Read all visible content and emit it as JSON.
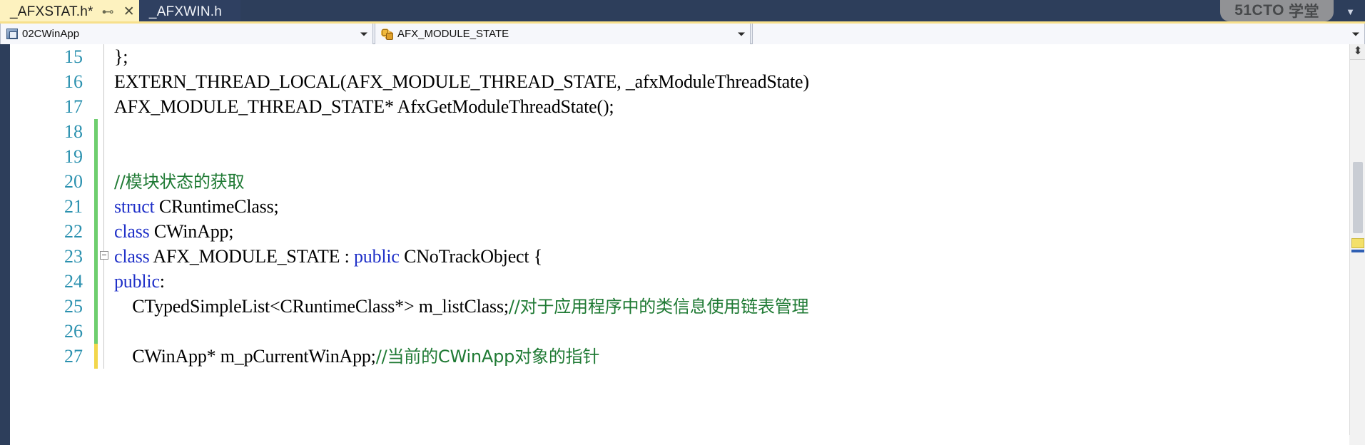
{
  "window": {
    "watermark_brand": "51CTO",
    "watermark_suffix": "学堂"
  },
  "tabs": {
    "items": [
      {
        "label": "_AFXSTAT.h*",
        "active": true,
        "pin_icon": "pin-icon",
        "close_icon": "close-icon"
      },
      {
        "label": "_AFXWIN.h",
        "active": false
      }
    ],
    "overflow_icon": "chevron-down-icon"
  },
  "navbar": {
    "scope_combo": {
      "value": "02CWinApp",
      "icon": "class-icon"
    },
    "type_combo": {
      "value": "AFX_MODULE_STATE",
      "icon": "struct-icon"
    },
    "member_combo": {
      "value": ""
    },
    "dropdown_icon": "chevron-down-icon"
  },
  "editor": {
    "split_icon": "split-view-icon",
    "lines": [
      {
        "num": "15",
        "change": "none",
        "fold": "none",
        "tokens": [
          {
            "t": "};",
            "c": "plain"
          }
        ]
      },
      {
        "num": "16",
        "change": "none",
        "fold": "none",
        "tokens": [
          {
            "t": "EXTERN_THREAD_LOCAL(AFX_MODULE_THREAD_STATE, _afxModuleThreadState)",
            "c": "plain"
          }
        ]
      },
      {
        "num": "17",
        "change": "none",
        "fold": "none",
        "tokens": [
          {
            "t": "AFX_MODULE_THREAD_STATE* AfxGetModuleThreadState();",
            "c": "plain"
          }
        ]
      },
      {
        "num": "18",
        "change": "green",
        "fold": "none",
        "tokens": [
          {
            "t": "",
            "c": "plain"
          }
        ]
      },
      {
        "num": "19",
        "change": "green",
        "fold": "none",
        "tokens": [
          {
            "t": "",
            "c": "plain"
          }
        ]
      },
      {
        "num": "20",
        "change": "green",
        "fold": "none",
        "tokens": [
          {
            "t": "//模块状态的获取",
            "c": "comment"
          }
        ]
      },
      {
        "num": "21",
        "change": "green",
        "fold": "none",
        "tokens": [
          {
            "t": "struct",
            "c": "keyword"
          },
          {
            "t": " CRuntimeClass;",
            "c": "plain"
          }
        ]
      },
      {
        "num": "22",
        "change": "green",
        "fold": "none",
        "tokens": [
          {
            "t": "class",
            "c": "keyword"
          },
          {
            "t": " CWinApp;",
            "c": "plain"
          }
        ]
      },
      {
        "num": "23",
        "change": "green",
        "fold": "collapse",
        "tokens": [
          {
            "t": "class",
            "c": "keyword"
          },
          {
            "t": " AFX_MODULE_STATE : ",
            "c": "plain"
          },
          {
            "t": "public",
            "c": "keyword"
          },
          {
            "t": " CNoTrackObject {",
            "c": "plain"
          }
        ]
      },
      {
        "num": "24",
        "change": "green",
        "fold": "none",
        "tokens": [
          {
            "t": "public",
            "c": "keyword"
          },
          {
            "t": ":",
            "c": "plain"
          }
        ]
      },
      {
        "num": "25",
        "change": "green",
        "fold": "none",
        "tokens": [
          {
            "t": "    CTypedSimpleList<CRuntimeClass*> m_listClass;",
            "c": "plain"
          },
          {
            "t": "//对于应用程序中的类信息使用链表管理",
            "c": "comment"
          }
        ]
      },
      {
        "num": "26",
        "change": "green",
        "fold": "none",
        "tokens": [
          {
            "t": "",
            "c": "plain"
          }
        ]
      },
      {
        "num": "27",
        "change": "yellow",
        "fold": "none",
        "tokens": [
          {
            "t": "    CWinApp* m_pCurrentWinApp;",
            "c": "plain"
          },
          {
            "t": "//当前的CWinApp对象的指针",
            "c": "comment"
          }
        ]
      }
    ]
  },
  "colors": {
    "tab_active_bg": "#fdf2bf",
    "tab_inactive_bg": "#2f4061",
    "chrome_bg": "#2d3e5b",
    "line_number": "#2b91af",
    "keyword": "#1f30c8",
    "comment": "#1f7a34",
    "change_green": "#6ece6e",
    "change_yellow": "#f2d64b"
  }
}
